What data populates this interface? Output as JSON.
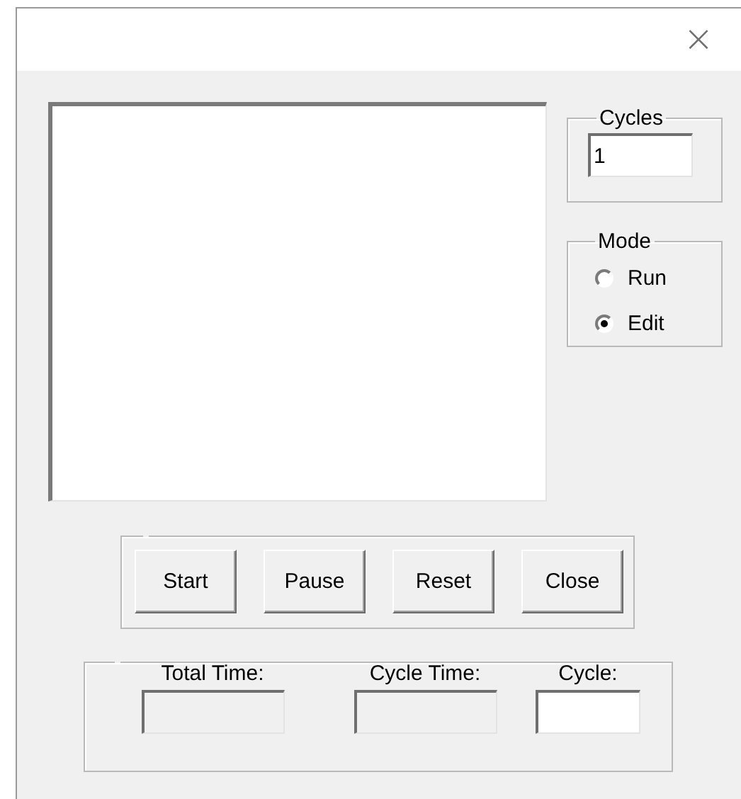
{
  "window": {
    "close_glyph": "×"
  },
  "cycles": {
    "label": "Cycles",
    "value": "1"
  },
  "mode": {
    "label": "Mode",
    "options": [
      {
        "label": "Run",
        "selected": false
      },
      {
        "label": "Edit",
        "selected": true
      }
    ]
  },
  "buttons": [
    "Start",
    "Pause",
    "Reset",
    "Close"
  ],
  "status": [
    {
      "label": "Total Time:",
      "disabled": true
    },
    {
      "label": "Cycle Time:",
      "disabled": true
    },
    {
      "label": "Cycle:",
      "disabled": false
    }
  ]
}
